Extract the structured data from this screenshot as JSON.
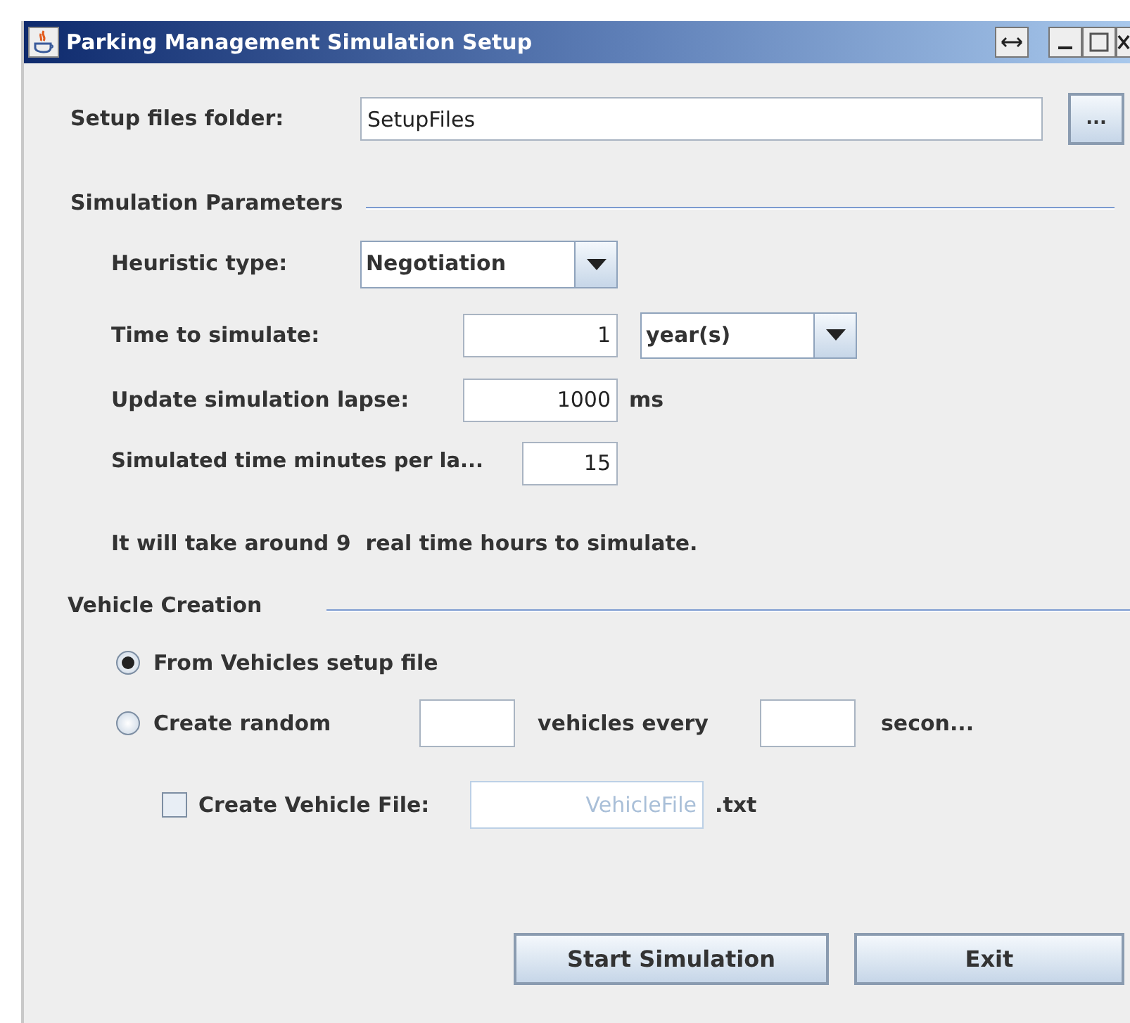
{
  "window": {
    "title": "Parking Management Simulation Setup"
  },
  "setup_folder": {
    "label": "Setup files folder:",
    "value": "SetupFiles",
    "browse_button": "..."
  },
  "simulation_parameters": {
    "heading": "Simulation Parameters",
    "heuristic": {
      "label": "Heuristic type:",
      "value": "Negotiation"
    },
    "time_to_simulate": {
      "label": "Time to simulate:",
      "value": "1",
      "unit": "year(s)"
    },
    "update_lapse": {
      "label": "Update simulation lapse:",
      "value": "1000",
      "unit": "ms"
    },
    "minutes_per_lapse": {
      "label": "Simulated time minutes per la...",
      "value": "15"
    },
    "estimate": "It will take around 9  real time hours to simulate."
  },
  "vehicle_creation": {
    "heading": "Vehicle Creation",
    "options": [
      {
        "label": "From Vehicles setup file",
        "selected": true
      },
      {
        "label": "Create random",
        "selected": false
      }
    ],
    "random_vehicles_text": "vehicles every",
    "random_seconds_text": "secon...",
    "create_file": {
      "label": "Create Vehicle File:",
      "checked": false,
      "placeholder": "VehicleFile",
      "extension": ".txt"
    }
  },
  "buttons": [
    "Start Simulation",
    "Exit"
  ]
}
